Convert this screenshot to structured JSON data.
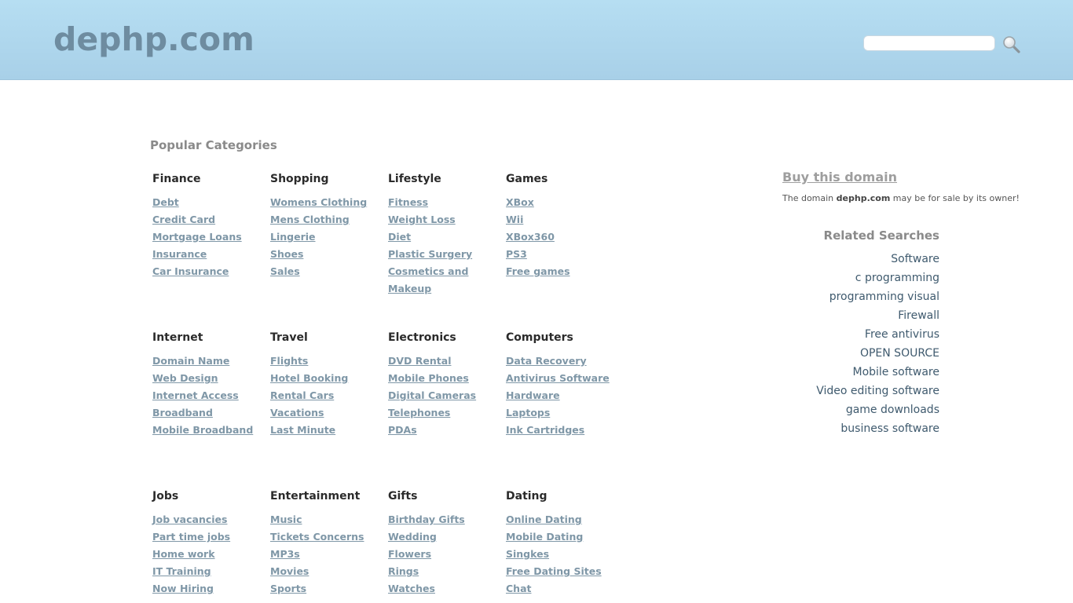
{
  "header": {
    "logo": "dephp.com",
    "search": {
      "value": "",
      "placeholder": ""
    }
  },
  "popular": {
    "title": "Popular Categories",
    "categories": [
      {
        "title": "Finance",
        "links": [
          "Debt",
          "Credit Card",
          "Mortgage Loans",
          "Insurance",
          "Car Insurance"
        ]
      },
      {
        "title": "Shopping",
        "links": [
          "Womens Clothing",
          "Mens Clothing",
          "Lingerie",
          "Shoes",
          "Sales"
        ]
      },
      {
        "title": "Lifestyle",
        "links": [
          "Fitness",
          "Weight Loss",
          "Diet",
          "Plastic Surgery",
          "Cosmetics and Makeup"
        ]
      },
      {
        "title": "Games",
        "links": [
          "XBox",
          "Wii",
          "XBox360",
          "PS3",
          "Free games"
        ]
      },
      {
        "title": "Internet",
        "links": [
          "Domain Name",
          "Web Design",
          "Internet Access",
          "Broadband",
          "Mobile Broadband"
        ]
      },
      {
        "title": "Travel",
        "links": [
          "Flights",
          "Hotel Booking",
          "Rental Cars",
          "Vacations",
          "Last Minute"
        ]
      },
      {
        "title": "Electronics",
        "links": [
          "DVD Rental",
          "Mobile Phones",
          "Digital Cameras",
          "Telephones",
          "PDAs"
        ]
      },
      {
        "title": "Computers",
        "links": [
          "Data Recovery",
          "Antivirus Software",
          "Hardware",
          "Laptops",
          "Ink Cartridges"
        ]
      },
      {
        "title": "Jobs",
        "links": [
          "Job vacancies",
          "Part time jobs",
          "Home work",
          "IT Training",
          "Now Hiring"
        ]
      },
      {
        "title": "Entertainment",
        "links": [
          "Music",
          "Tickets Concerns",
          "MP3s",
          "Movies",
          "Sports"
        ]
      },
      {
        "title": "Gifts",
        "links": [
          "Birthday Gifts",
          "Wedding",
          "Flowers",
          "Rings",
          "Watches"
        ]
      },
      {
        "title": "Dating",
        "links": [
          "Online Dating",
          "Mobile Dating",
          "Singkes",
          "Free Dating Sites",
          "Chat"
        ]
      }
    ]
  },
  "sidebar": {
    "buy_label": "Buy this domain",
    "sale_prefix": "The domain ",
    "sale_domain": "dephp.com",
    "sale_suffix": " may be for sale by its owner!",
    "related_title": "Related Searches",
    "related": [
      "Software",
      "c programming",
      "programming visual",
      "Firewall",
      "Free antivirus",
      "OPEN SOURCE",
      "Mobile software",
      "Video editing software",
      "game downloads",
      "business software"
    ]
  },
  "icons": {
    "search": "magnifier-icon"
  },
  "colors": {
    "header_top": "#b6def2",
    "header_bottom": "#a8d0e8",
    "logo": "#6e8ca0",
    "link": "#7f97a7"
  }
}
